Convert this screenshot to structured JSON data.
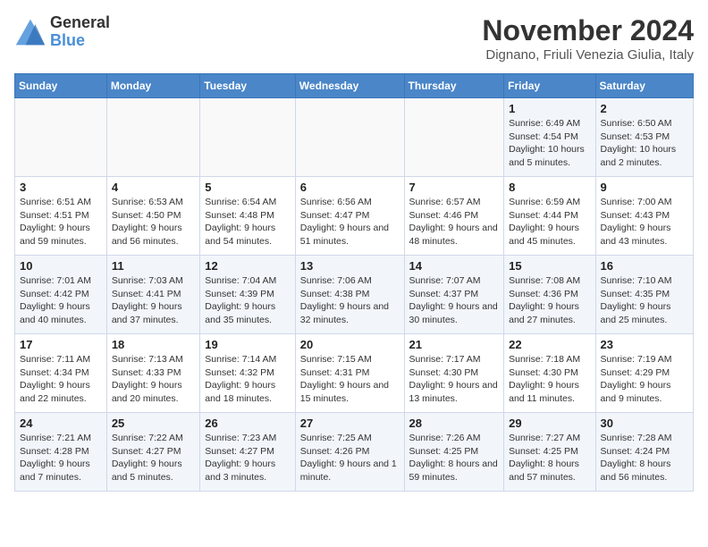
{
  "logo": {
    "general": "General",
    "blue": "Blue"
  },
  "title": "November 2024",
  "subtitle": "Dignano, Friuli Venezia Giulia, Italy",
  "days_of_week": [
    "Sunday",
    "Monday",
    "Tuesday",
    "Wednesday",
    "Thursday",
    "Friday",
    "Saturday"
  ],
  "weeks": [
    [
      {
        "day": "",
        "info": ""
      },
      {
        "day": "",
        "info": ""
      },
      {
        "day": "",
        "info": ""
      },
      {
        "day": "",
        "info": ""
      },
      {
        "day": "",
        "info": ""
      },
      {
        "day": "1",
        "info": "Sunrise: 6:49 AM\nSunset: 4:54 PM\nDaylight: 10 hours and 5 minutes."
      },
      {
        "day": "2",
        "info": "Sunrise: 6:50 AM\nSunset: 4:53 PM\nDaylight: 10 hours and 2 minutes."
      }
    ],
    [
      {
        "day": "3",
        "info": "Sunrise: 6:51 AM\nSunset: 4:51 PM\nDaylight: 9 hours and 59 minutes."
      },
      {
        "day": "4",
        "info": "Sunrise: 6:53 AM\nSunset: 4:50 PM\nDaylight: 9 hours and 56 minutes."
      },
      {
        "day": "5",
        "info": "Sunrise: 6:54 AM\nSunset: 4:48 PM\nDaylight: 9 hours and 54 minutes."
      },
      {
        "day": "6",
        "info": "Sunrise: 6:56 AM\nSunset: 4:47 PM\nDaylight: 9 hours and 51 minutes."
      },
      {
        "day": "7",
        "info": "Sunrise: 6:57 AM\nSunset: 4:46 PM\nDaylight: 9 hours and 48 minutes."
      },
      {
        "day": "8",
        "info": "Sunrise: 6:59 AM\nSunset: 4:44 PM\nDaylight: 9 hours and 45 minutes."
      },
      {
        "day": "9",
        "info": "Sunrise: 7:00 AM\nSunset: 4:43 PM\nDaylight: 9 hours and 43 minutes."
      }
    ],
    [
      {
        "day": "10",
        "info": "Sunrise: 7:01 AM\nSunset: 4:42 PM\nDaylight: 9 hours and 40 minutes."
      },
      {
        "day": "11",
        "info": "Sunrise: 7:03 AM\nSunset: 4:41 PM\nDaylight: 9 hours and 37 minutes."
      },
      {
        "day": "12",
        "info": "Sunrise: 7:04 AM\nSunset: 4:39 PM\nDaylight: 9 hours and 35 minutes."
      },
      {
        "day": "13",
        "info": "Sunrise: 7:06 AM\nSunset: 4:38 PM\nDaylight: 9 hours and 32 minutes."
      },
      {
        "day": "14",
        "info": "Sunrise: 7:07 AM\nSunset: 4:37 PM\nDaylight: 9 hours and 30 minutes."
      },
      {
        "day": "15",
        "info": "Sunrise: 7:08 AM\nSunset: 4:36 PM\nDaylight: 9 hours and 27 minutes."
      },
      {
        "day": "16",
        "info": "Sunrise: 7:10 AM\nSunset: 4:35 PM\nDaylight: 9 hours and 25 minutes."
      }
    ],
    [
      {
        "day": "17",
        "info": "Sunrise: 7:11 AM\nSunset: 4:34 PM\nDaylight: 9 hours and 22 minutes."
      },
      {
        "day": "18",
        "info": "Sunrise: 7:13 AM\nSunset: 4:33 PM\nDaylight: 9 hours and 20 minutes."
      },
      {
        "day": "19",
        "info": "Sunrise: 7:14 AM\nSunset: 4:32 PM\nDaylight: 9 hours and 18 minutes."
      },
      {
        "day": "20",
        "info": "Sunrise: 7:15 AM\nSunset: 4:31 PM\nDaylight: 9 hours and 15 minutes."
      },
      {
        "day": "21",
        "info": "Sunrise: 7:17 AM\nSunset: 4:30 PM\nDaylight: 9 hours and 13 minutes."
      },
      {
        "day": "22",
        "info": "Sunrise: 7:18 AM\nSunset: 4:30 PM\nDaylight: 9 hours and 11 minutes."
      },
      {
        "day": "23",
        "info": "Sunrise: 7:19 AM\nSunset: 4:29 PM\nDaylight: 9 hours and 9 minutes."
      }
    ],
    [
      {
        "day": "24",
        "info": "Sunrise: 7:21 AM\nSunset: 4:28 PM\nDaylight: 9 hours and 7 minutes."
      },
      {
        "day": "25",
        "info": "Sunrise: 7:22 AM\nSunset: 4:27 PM\nDaylight: 9 hours and 5 minutes."
      },
      {
        "day": "26",
        "info": "Sunrise: 7:23 AM\nSunset: 4:27 PM\nDaylight: 9 hours and 3 minutes."
      },
      {
        "day": "27",
        "info": "Sunrise: 7:25 AM\nSunset: 4:26 PM\nDaylight: 9 hours and 1 minute."
      },
      {
        "day": "28",
        "info": "Sunrise: 7:26 AM\nSunset: 4:25 PM\nDaylight: 8 hours and 59 minutes."
      },
      {
        "day": "29",
        "info": "Sunrise: 7:27 AM\nSunset: 4:25 PM\nDaylight: 8 hours and 57 minutes."
      },
      {
        "day": "30",
        "info": "Sunrise: 7:28 AM\nSunset: 4:24 PM\nDaylight: 8 hours and 56 minutes."
      }
    ]
  ]
}
